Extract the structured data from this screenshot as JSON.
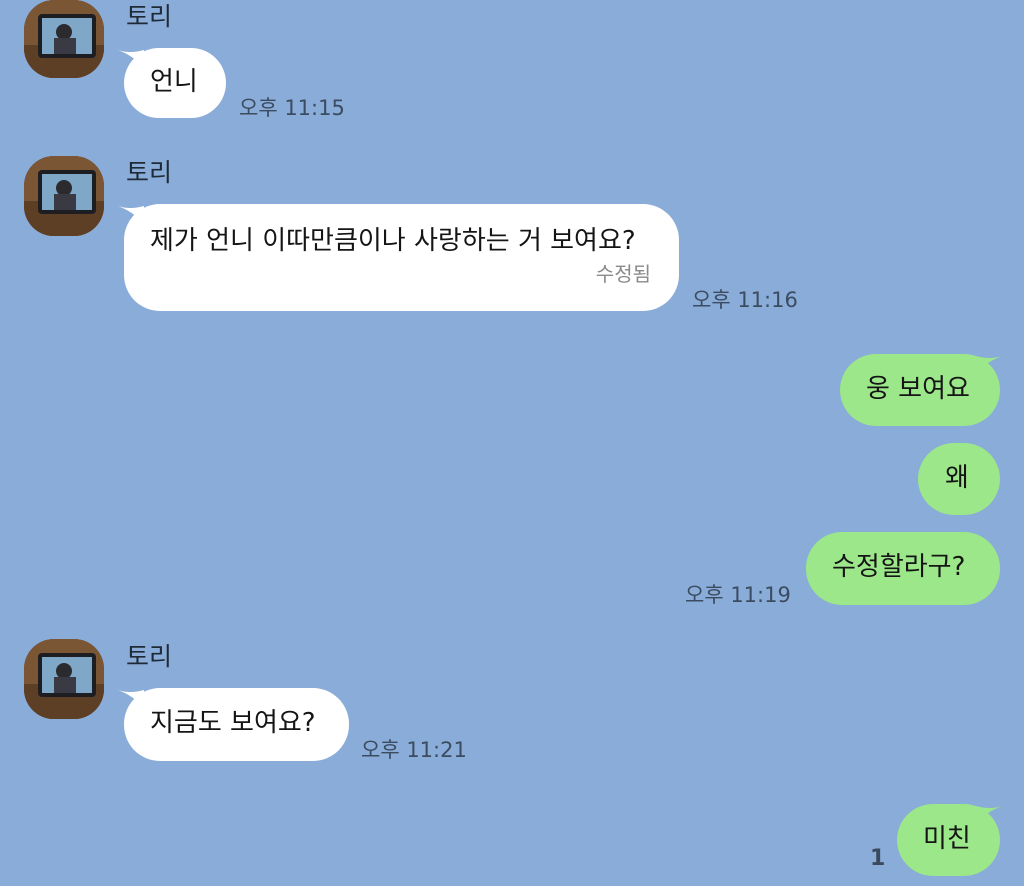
{
  "contact": {
    "name": "토리"
  },
  "messages": [
    {
      "sender": "토리",
      "text": "언니",
      "time": "오후 11:15"
    },
    {
      "sender": "토리",
      "text": "제가 언니 이따만큼이나 사랑하는 거 보여요?",
      "edited_label": "수정됨",
      "time": "오후 11:16"
    },
    {
      "sender": "me",
      "text": "웅 보여요"
    },
    {
      "sender": "me",
      "text": "왜"
    },
    {
      "sender": "me",
      "text": "수정할라구?",
      "time": "오후 11:19"
    },
    {
      "sender": "토리",
      "text": "지금도 보여요?",
      "time": "오후 11:21"
    },
    {
      "sender": "me",
      "text": "미친",
      "unread_count": "1"
    }
  ],
  "colors": {
    "background": "#8aacd8",
    "incoming_bubble": "#ffffff",
    "outgoing_bubble": "#9be789",
    "timestamp": "#3c4c60"
  },
  "icons": {
    "avatar": "profile-photo-avatar"
  }
}
